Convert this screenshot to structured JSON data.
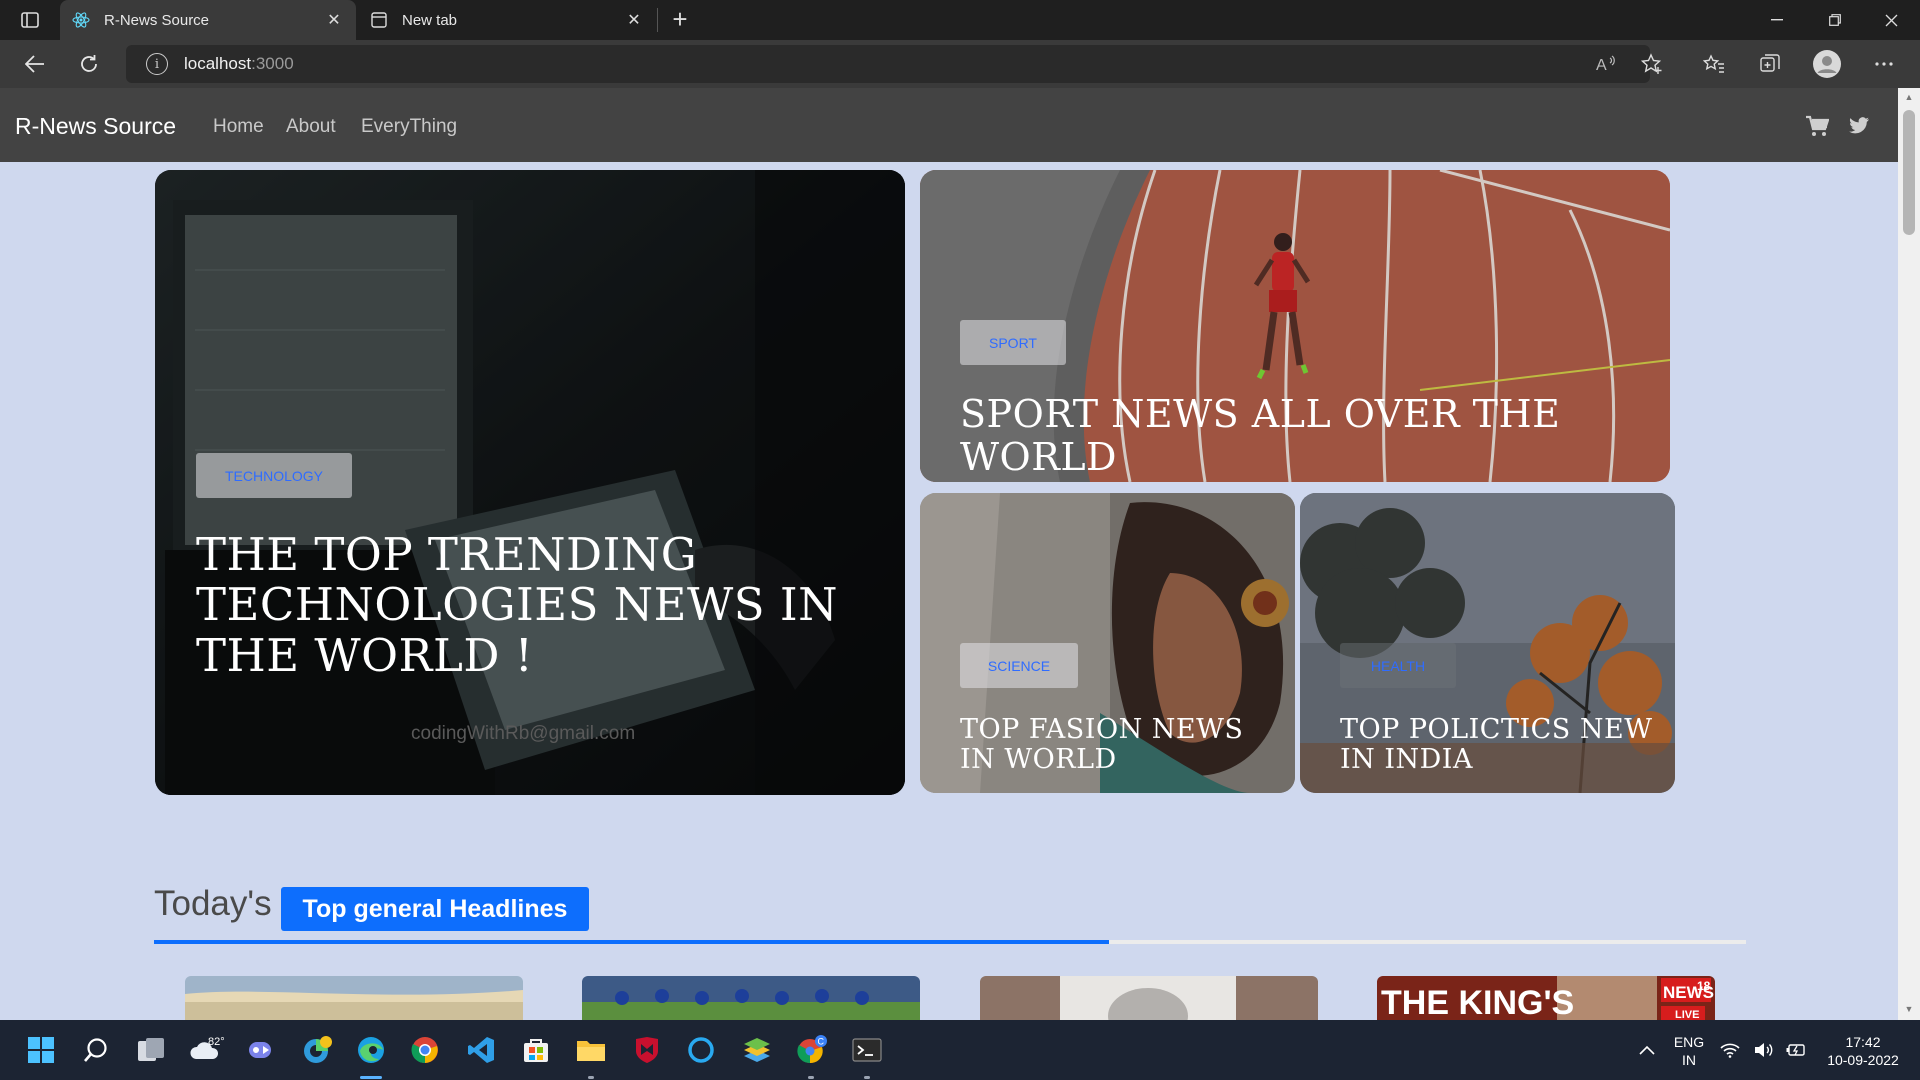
{
  "browser": {
    "tabs": [
      {
        "title": "R-News Source",
        "active": true
      },
      {
        "title": "New tab",
        "active": false
      }
    ],
    "url_host": "localhost",
    "url_port": ":3000"
  },
  "navbar": {
    "brand": "R-News Source",
    "links": [
      "Home",
      "About",
      "EveryThing"
    ]
  },
  "hero": {
    "technology": {
      "badge": "TECHNOLOGY",
      "title": "THE TOP TRENDING TECHNOLOGIES NEWS IN THE WORLD !",
      "email": "codingWithRb@gmail.com"
    },
    "sport": {
      "badge": "SPORT",
      "title": "SPORT NEWS ALL OVER THE WORLD"
    },
    "fashion": {
      "badge": "SCIENCE",
      "title": "TOP FASION NEWS IN WORLD"
    },
    "politics": {
      "badge": "HEALTH",
      "title": "TOP POLICTICS NEW IN INDIA"
    }
  },
  "headlines": {
    "prefix": "Today's",
    "pill": "Top general Headlines",
    "progress": 0.6
  },
  "thumbs": {
    "news18_text": "THE KING'S",
    "news18_logo": "NEWS",
    "news18_num": "18",
    "news18_live": "LIVE"
  },
  "taskbar": {
    "weather": "82°",
    "lang": "ENG",
    "region": "IN",
    "time": "17:42",
    "date": "10-09-2022"
  },
  "colors": {
    "accent": "#0d6efd",
    "page_bg": "#cfd8ee",
    "navbar": "#434343"
  }
}
